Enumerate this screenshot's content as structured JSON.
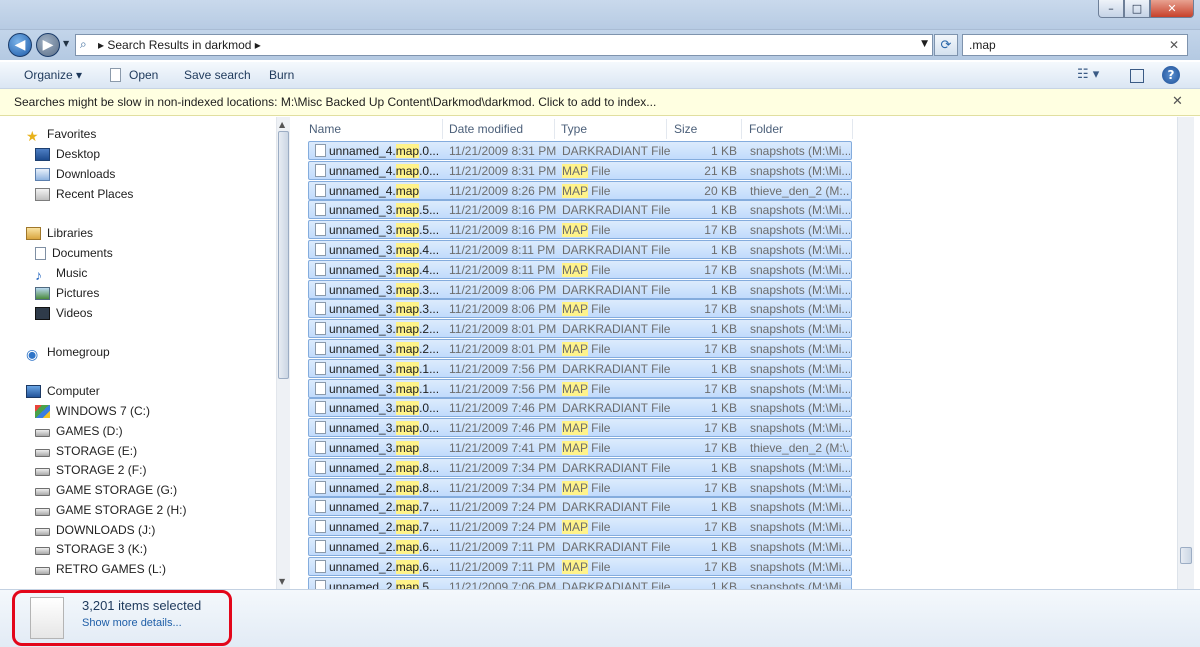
{
  "window": {
    "min": "–",
    "max": "□",
    "close": "✕"
  },
  "address": {
    "path": "Search Results in darkmod",
    "sep": "▸"
  },
  "search": {
    "value": ".map",
    "clear": "✕"
  },
  "toolbar": {
    "organize": "Organize ▾",
    "open": "Open",
    "save_search": "Save search",
    "burn": "Burn"
  },
  "infobar": {
    "message": "Searches might be slow in non-indexed locations: M:\\Misc Backed Up Content\\Darkmod\\darkmod. Click to add to index...",
    "close": "✕"
  },
  "nav": {
    "favorites": "Favorites",
    "desktop": "Desktop",
    "downloads": "Downloads",
    "recent": "Recent Places",
    "libraries": "Libraries",
    "documents": "Documents",
    "music": "Music",
    "pictures": "Pictures",
    "videos": "Videos",
    "homegroup": "Homegroup",
    "computer": "Computer",
    "drives": [
      "WINDOWS 7 (C:)",
      "GAMES (D:)",
      "STORAGE (E:)",
      "STORAGE 2 (F:)",
      "GAME STORAGE (G:)",
      "GAME STORAGE 2 (H:)",
      "DOWNLOADS (J:)",
      "STORAGE 3 (K:)",
      "RETRO GAMES (L:)"
    ]
  },
  "columns": {
    "name": "Name",
    "date": "Date modified",
    "type": "Type",
    "size": "Size",
    "folder": "Folder"
  },
  "files": [
    {
      "base": "unnamed_4.",
      "hl": "map",
      "rest": ".0...",
      "date": "11/21/2009 8:31 PM",
      "type_hl": "",
      "type": "DARKRADIANT File",
      "size": "1 KB",
      "folder": "snapshots (M:\\Mi..."
    },
    {
      "base": "unnamed_4.",
      "hl": "map",
      "rest": ".0...",
      "date": "11/21/2009 8:31 PM",
      "type_hl": "MAP",
      "type": " File",
      "size": "21 KB",
      "folder": "snapshots (M:\\Mi..."
    },
    {
      "base": "unnamed_4.",
      "hl": "map",
      "rest": "",
      "date": "11/21/2009 8:26 PM",
      "type_hl": "MAP",
      "type": " File",
      "size": "20 KB",
      "folder": "thieve_den_2 (M:..."
    },
    {
      "base": "unnamed_3.",
      "hl": "map",
      "rest": ".5...",
      "date": "11/21/2009 8:16 PM",
      "type_hl": "",
      "type": "DARKRADIANT File",
      "size": "1 KB",
      "folder": "snapshots (M:\\Mi..."
    },
    {
      "base": "unnamed_3.",
      "hl": "map",
      "rest": ".5...",
      "date": "11/21/2009 8:16 PM",
      "type_hl": "MAP",
      "type": " File",
      "size": "17 KB",
      "folder": "snapshots (M:\\Mi..."
    },
    {
      "base": "unnamed_3.",
      "hl": "map",
      "rest": ".4...",
      "date": "11/21/2009 8:11 PM",
      "type_hl": "",
      "type": "DARKRADIANT File",
      "size": "1 KB",
      "folder": "snapshots (M:\\Mi..."
    },
    {
      "base": "unnamed_3.",
      "hl": "map",
      "rest": ".4...",
      "date": "11/21/2009 8:11 PM",
      "type_hl": "MAP",
      "type": " File",
      "size": "17 KB",
      "folder": "snapshots (M:\\Mi..."
    },
    {
      "base": "unnamed_3.",
      "hl": "map",
      "rest": ".3...",
      "date": "11/21/2009 8:06 PM",
      "type_hl": "",
      "type": "DARKRADIANT File",
      "size": "1 KB",
      "folder": "snapshots (M:\\Mi..."
    },
    {
      "base": "unnamed_3.",
      "hl": "map",
      "rest": ".3...",
      "date": "11/21/2009 8:06 PM",
      "type_hl": "MAP",
      "type": " File",
      "size": "17 KB",
      "folder": "snapshots (M:\\Mi..."
    },
    {
      "base": "unnamed_3.",
      "hl": "map",
      "rest": ".2...",
      "date": "11/21/2009 8:01 PM",
      "type_hl": "",
      "type": "DARKRADIANT File",
      "size": "1 KB",
      "folder": "snapshots (M:\\Mi..."
    },
    {
      "base": "unnamed_3.",
      "hl": "map",
      "rest": ".2...",
      "date": "11/21/2009 8:01 PM",
      "type_hl": "MAP",
      "type": " File",
      "size": "17 KB",
      "folder": "snapshots (M:\\Mi..."
    },
    {
      "base": "unnamed_3.",
      "hl": "map",
      "rest": ".1...",
      "date": "11/21/2009 7:56 PM",
      "type_hl": "",
      "type": "DARKRADIANT File",
      "size": "1 KB",
      "folder": "snapshots (M:\\Mi..."
    },
    {
      "base": "unnamed_3.",
      "hl": "map",
      "rest": ".1...",
      "date": "11/21/2009 7:56 PM",
      "type_hl": "MAP",
      "type": " File",
      "size": "17 KB",
      "folder": "snapshots (M:\\Mi..."
    },
    {
      "base": "unnamed_3.",
      "hl": "map",
      "rest": ".0...",
      "date": "11/21/2009 7:46 PM",
      "type_hl": "",
      "type": "DARKRADIANT File",
      "size": "1 KB",
      "folder": "snapshots (M:\\Mi..."
    },
    {
      "base": "unnamed_3.",
      "hl": "map",
      "rest": ".0...",
      "date": "11/21/2009 7:46 PM",
      "type_hl": "MAP",
      "type": " File",
      "size": "17 KB",
      "folder": "snapshots (M:\\Mi..."
    },
    {
      "base": "unnamed_3.",
      "hl": "map",
      "rest": "",
      "date": "11/21/2009 7:41 PM",
      "type_hl": "MAP",
      "type": " File",
      "size": "17 KB",
      "folder": "thieve_den_2 (M:\\..."
    },
    {
      "base": "unnamed_2.",
      "hl": "map",
      "rest": ".8...",
      "date": "11/21/2009 7:34 PM",
      "type_hl": "",
      "type": "DARKRADIANT File",
      "size": "1 KB",
      "folder": "snapshots (M:\\Mi..."
    },
    {
      "base": "unnamed_2.",
      "hl": "map",
      "rest": ".8...",
      "date": "11/21/2009 7:34 PM",
      "type_hl": "MAP",
      "type": " File",
      "size": "17 KB",
      "folder": "snapshots (M:\\Mi..."
    },
    {
      "base": "unnamed_2.",
      "hl": "map",
      "rest": ".7...",
      "date": "11/21/2009 7:24 PM",
      "type_hl": "",
      "type": "DARKRADIANT File",
      "size": "1 KB",
      "folder": "snapshots (M:\\Mi..."
    },
    {
      "base": "unnamed_2.",
      "hl": "map",
      "rest": ".7...",
      "date": "11/21/2009 7:24 PM",
      "type_hl": "MAP",
      "type": " File",
      "size": "17 KB",
      "folder": "snapshots (M:\\Mi..."
    },
    {
      "base": "unnamed_2.",
      "hl": "map",
      "rest": ".6...",
      "date": "11/21/2009 7:11 PM",
      "type_hl": "",
      "type": "DARKRADIANT File",
      "size": "1 KB",
      "folder": "snapshots (M:\\Mi..."
    },
    {
      "base": "unnamed_2.",
      "hl": "map",
      "rest": ".6...",
      "date": "11/21/2009 7:11 PM",
      "type_hl": "MAP",
      "type": " File",
      "size": "17 KB",
      "folder": "snapshots (M:\\Mi..."
    },
    {
      "base": "unnamed_2.",
      "hl": "map",
      "rest": ".5...",
      "date": "11/21/2009 7:06 PM",
      "type_hl": "",
      "type": "DARKRADIANT File",
      "size": "1 KB",
      "folder": "snapshots (M:\\Mi..."
    }
  ],
  "details": {
    "count": "3,201 items selected",
    "more": "Show more details..."
  },
  "colors": {
    "selection": "#c1dbfc",
    "highlight": "#fff38a",
    "annotation": "#e3061a"
  },
  "icons": {
    "back": "back-arrow-icon",
    "forward": "forward-arrow-icon",
    "search": "search-icon",
    "refresh": "refresh-icon",
    "views": "views-icon",
    "preview": "preview-pane-icon",
    "help": "help-icon"
  }
}
